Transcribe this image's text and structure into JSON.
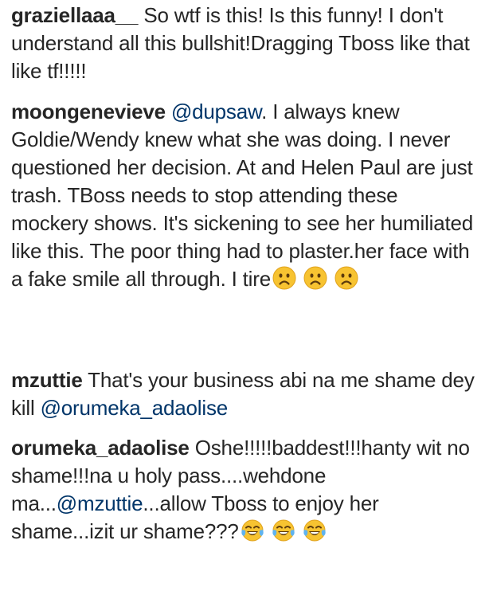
{
  "comments": [
    {
      "username": "graziellaaa__",
      "text": "So wtf is this! Is this funny! I don't understand all this bullshit!Dragging Tboss like that like tf!!!!!"
    },
    {
      "username": "moongenevieve",
      "mention": "@dupsaw",
      "text": ". I always knew Goldie/Wendy knew what she was doing. I never questioned her decision. At and Helen Paul are just trash. TBoss needs to stop attending these mockery shows. It's sickening to see her humiliated like this. The poor thing had to plaster.her face with a fake smile all through. I tire",
      "emojis": [
        "frowning-face-emoji",
        "frowning-face-emoji",
        "frowning-face-emoji"
      ]
    },
    {
      "username": "mzuttie",
      "text": "That's your business abi na me shame dey kill",
      "mention": "@orumeka_adaolise"
    },
    {
      "username": "orumeka_adaolise",
      "text_before": "Oshe!!!!!baddest!!!hanty wit no shame!!!na u holy pass....wehdone ma...",
      "mention": "@mzuttie",
      "text_after": "...allow Tboss to enjoy her shame...izit ur shame???",
      "emojis": [
        "tears-of-joy-emoji",
        "tears-of-joy-emoji",
        "tears-of-joy-emoji"
      ]
    }
  ],
  "colors": {
    "text": "#262626",
    "mention": "#003569",
    "background": "#ffffff"
  }
}
